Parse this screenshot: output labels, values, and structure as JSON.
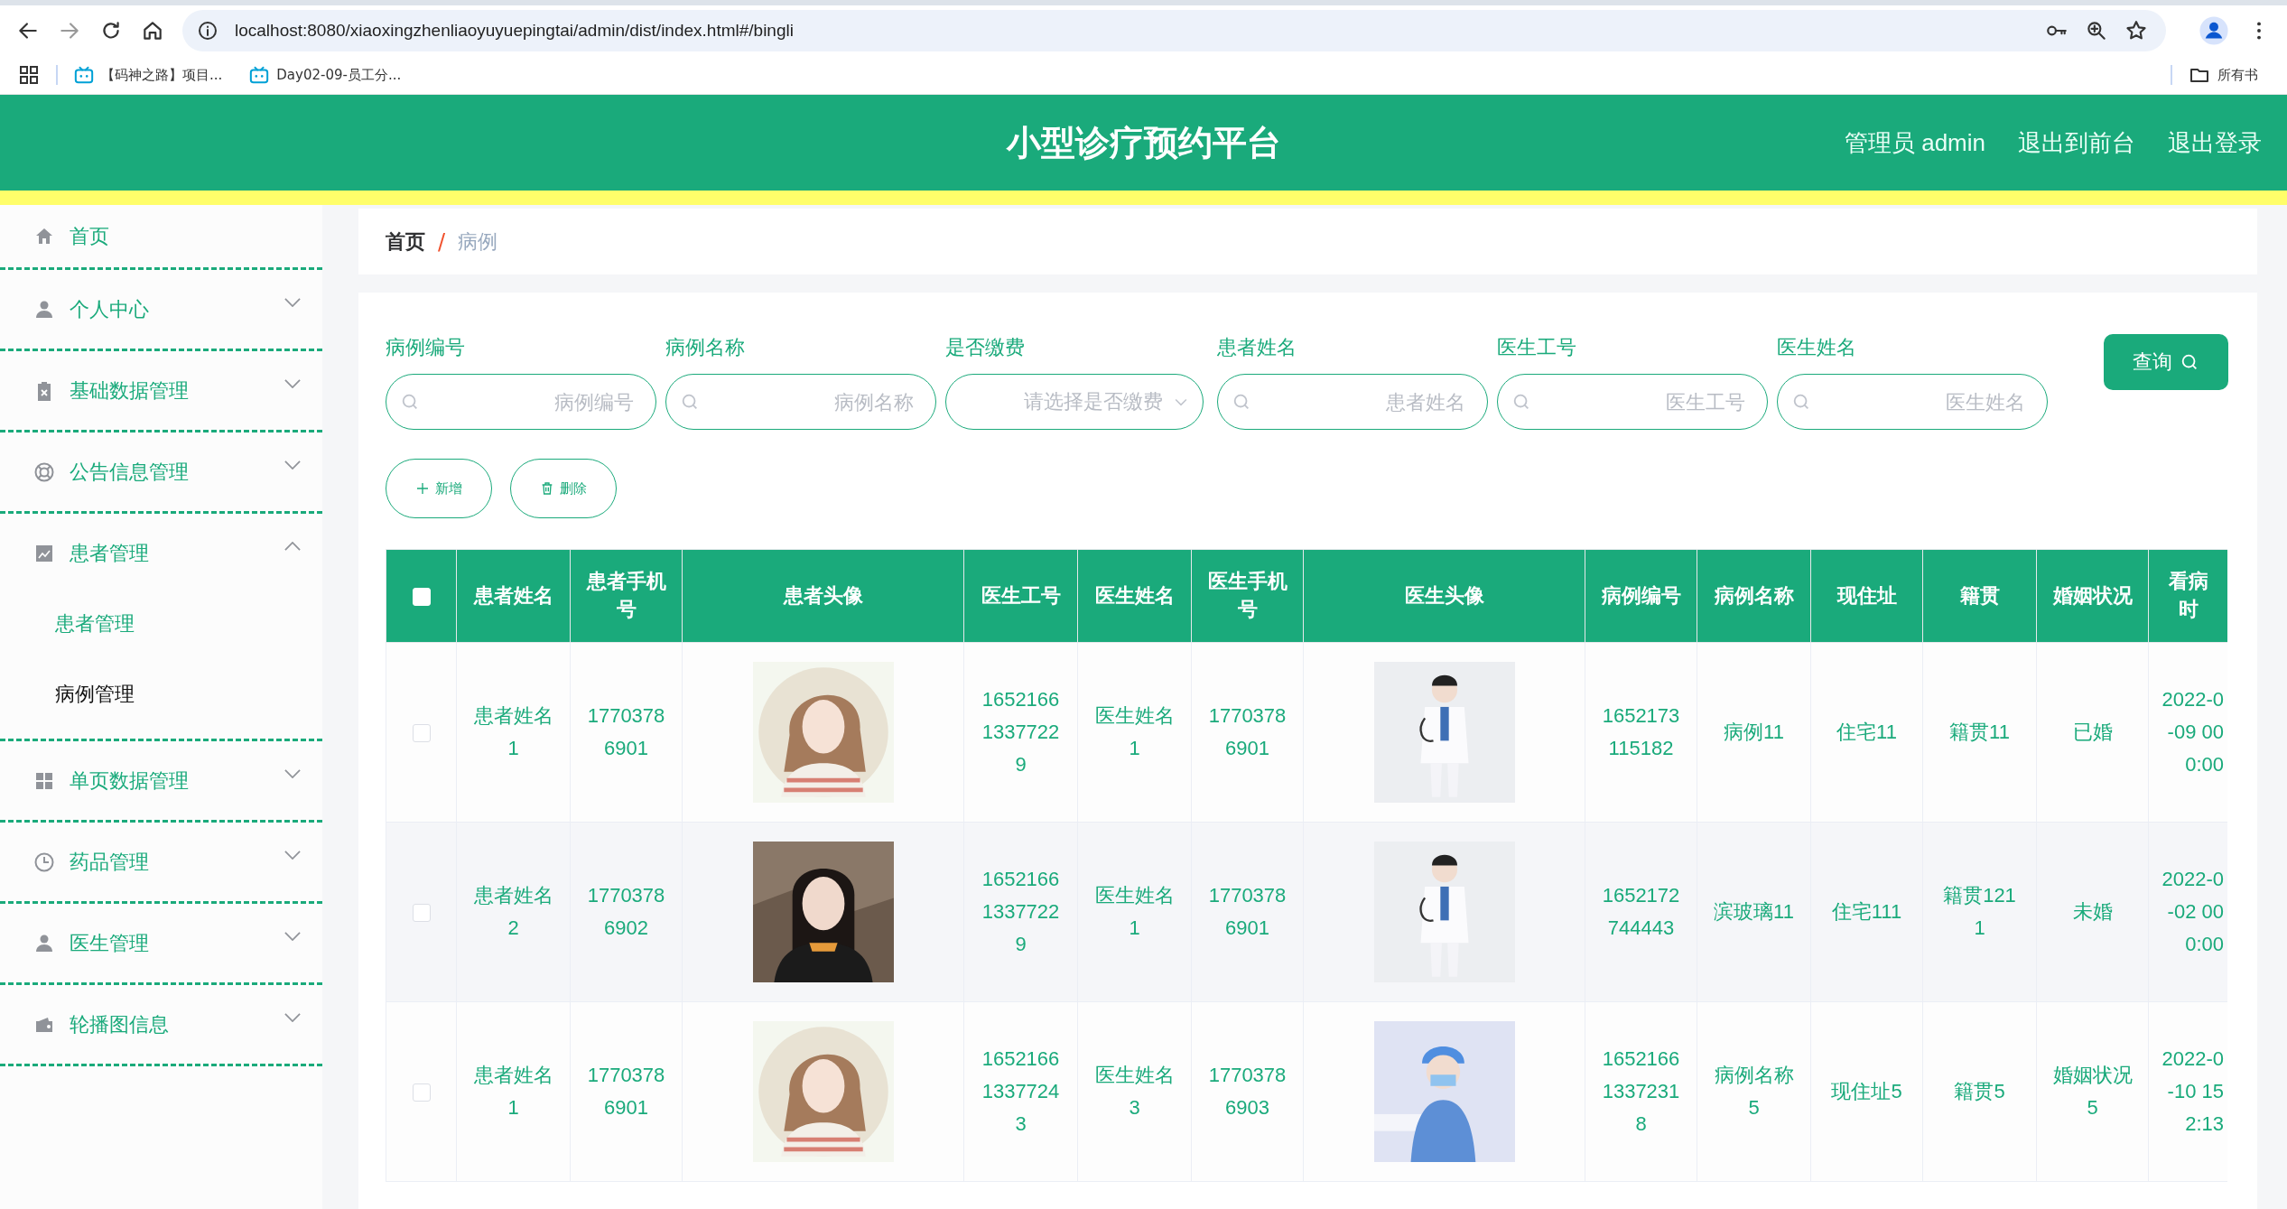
{
  "browser": {
    "url": "localhost:8080/xiaoxingzhenliaoyuyuepingtai/admin/dist/index.html#/bingli",
    "bookmarks": [
      "【码神之路】项目...",
      "Day02-09-员工分..."
    ],
    "all_bookmarks": "所有书"
  },
  "header": {
    "title": "小型诊疗预约平台",
    "links": [
      "管理员 admin",
      "退出到前台",
      "退出登录"
    ]
  },
  "sidebar": {
    "items": [
      {
        "label": "首页"
      },
      {
        "label": "个人中心",
        "expanded": false
      },
      {
        "label": "基础数据管理",
        "expanded": false
      },
      {
        "label": "公告信息管理",
        "expanded": false
      },
      {
        "label": "患者管理",
        "expanded": true,
        "children": [
          {
            "label": "患者管理",
            "selected": false
          },
          {
            "label": "病例管理",
            "selected": true
          }
        ]
      },
      {
        "label": "单页数据管理",
        "expanded": false
      },
      {
        "label": "药品管理",
        "expanded": false
      },
      {
        "label": "医生管理",
        "expanded": false
      },
      {
        "label": "轮播图信息",
        "expanded": false
      }
    ]
  },
  "breadcrumb": {
    "items": [
      "首页",
      "病例"
    ],
    "separator": "/"
  },
  "search": {
    "fields": [
      {
        "kind": "input",
        "label": "病例编号",
        "placeholder": "病例编号"
      },
      {
        "kind": "input",
        "label": "病例名称",
        "placeholder": "病例名称"
      },
      {
        "kind": "select",
        "label": "是否缴费",
        "placeholder": "请选择是否缴费"
      },
      {
        "kind": "input",
        "label": "患者姓名",
        "placeholder": "患者姓名"
      },
      {
        "kind": "input",
        "label": "医生工号",
        "placeholder": "医生工号"
      },
      {
        "kind": "input",
        "label": "医生姓名",
        "placeholder": "医生姓名"
      }
    ],
    "button": "查询"
  },
  "actions": [
    {
      "kind": "add",
      "label": "新增"
    },
    {
      "kind": "delete",
      "label": "删除"
    }
  ],
  "table": {
    "select_all": false,
    "columns": [
      {
        "kind": "text",
        "label": "患者姓名"
      },
      {
        "kind": "text",
        "label": "患者手机号"
      },
      {
        "kind": "picture",
        "label": "患者头像"
      },
      {
        "kind": "text",
        "label": "医生工号"
      },
      {
        "kind": "text",
        "label": "医生姓名"
      },
      {
        "kind": "text",
        "label": "医生手机号"
      },
      {
        "kind": "picture",
        "label": "医生头像"
      },
      {
        "kind": "text",
        "label": "病例编号"
      },
      {
        "kind": "text",
        "label": "病例名称"
      },
      {
        "kind": "text",
        "label": "现住址"
      },
      {
        "kind": "text",
        "label": "籍贯"
      },
      {
        "kind": "text",
        "label": "婚姻状况"
      },
      {
        "kind": "lines",
        "label": "看病时"
      }
    ],
    "rows": [
      {
        "checked": false,
        "cells": [
          "患者姓名1",
          "17703786901",
          {
            "kind": "picture"
          },
          "165216613377229",
          "医生姓名1",
          "17703786901",
          {
            "kind": "picture"
          },
          "1652173115182",
          "病例11",
          "住宅11",
          "籍贯11",
          "已婚",
          "2022-0\n-09 00\n0:00"
        ]
      },
      {
        "checked": false,
        "cells": [
          "患者姓名2",
          "17703786902",
          {
            "kind": "picture"
          },
          "165216613377229",
          "医生姓名1",
          "17703786901",
          {
            "kind": "picture"
          },
          "1652172744443",
          "滨玻璃11",
          "住宅111",
          "籍贯1211",
          "未婚",
          "2022-0\n-02 00\n0:00"
        ]
      },
      {
        "checked": false,
        "cells": [
          "患者姓名1",
          "17703786901",
          {
            "kind": "picture"
          },
          "165216613377243",
          "医生姓名3",
          "17703786903",
          {
            "kind": "picture"
          },
          "165216613372318",
          "病例名称5",
          "现住址5",
          "籍贯5",
          "婚姻状况5",
          "2022-0\n-10 15\n2:13"
        ]
      }
    ]
  }
}
